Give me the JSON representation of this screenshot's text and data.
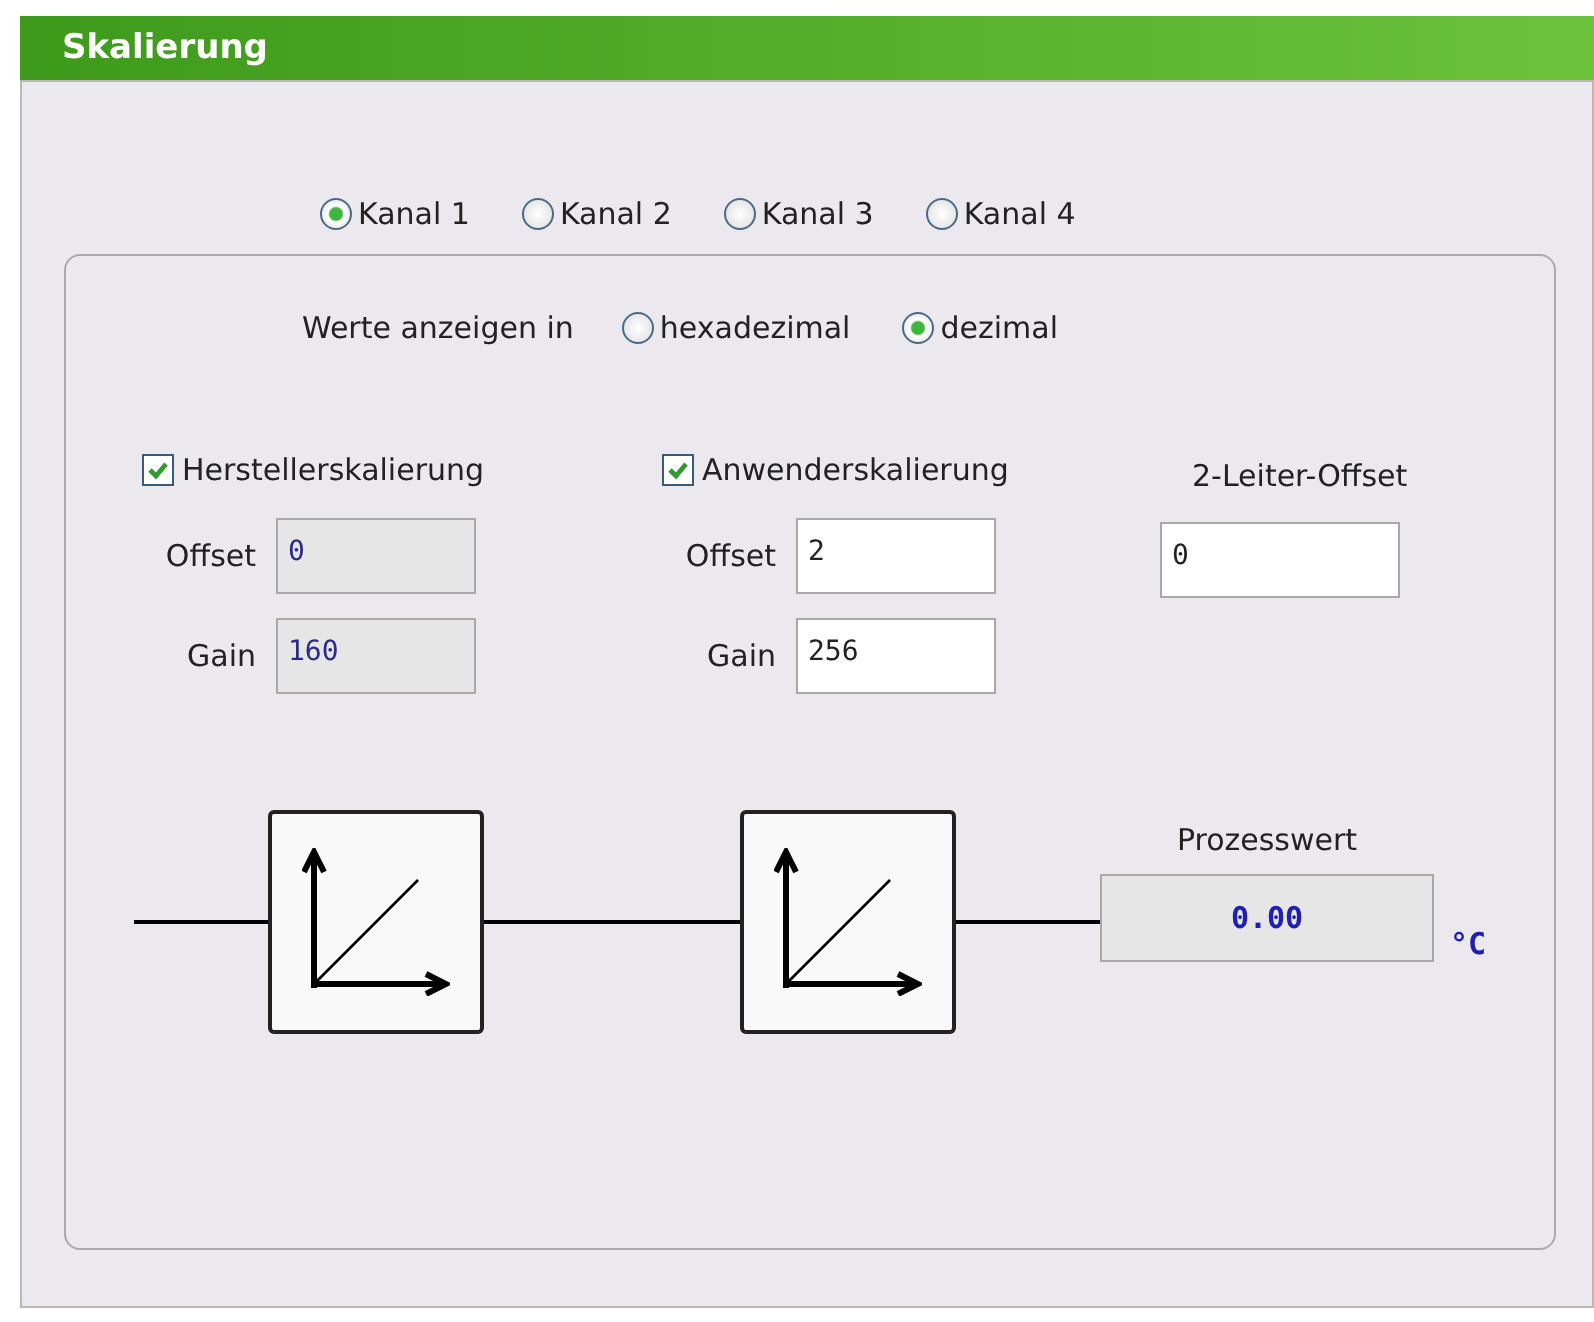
{
  "title": "Skalierung",
  "channels": [
    {
      "label": "Kanal 1",
      "selected": true
    },
    {
      "label": "Kanal 2",
      "selected": false
    },
    {
      "label": "Kanal 3",
      "selected": false
    },
    {
      "label": "Kanal 4",
      "selected": false
    }
  ],
  "display": {
    "label": "Werte anzeigen in",
    "options": [
      {
        "label": "hexadezimal",
        "selected": false
      },
      {
        "label": "dezimal",
        "selected": true
      }
    ]
  },
  "groups": [
    {
      "label": "Herstellerskalierung",
      "checked": true,
      "fields": [
        {
          "label": "Offset",
          "value": "0",
          "disabled": true
        },
        {
          "label": "Gain",
          "value": "160",
          "disabled": true
        }
      ]
    },
    {
      "label": "Anwenderskalierung",
      "checked": true,
      "fields": [
        {
          "label": "Offset",
          "value": "2",
          "disabled": false
        },
        {
          "label": "Gain",
          "value": "256",
          "disabled": false
        }
      ]
    }
  ],
  "two_wire": {
    "label": "2-Leiter-Offset",
    "value": "0"
  },
  "process": {
    "label": "Prozesswert",
    "value": "0.00",
    "unit": "°C"
  }
}
